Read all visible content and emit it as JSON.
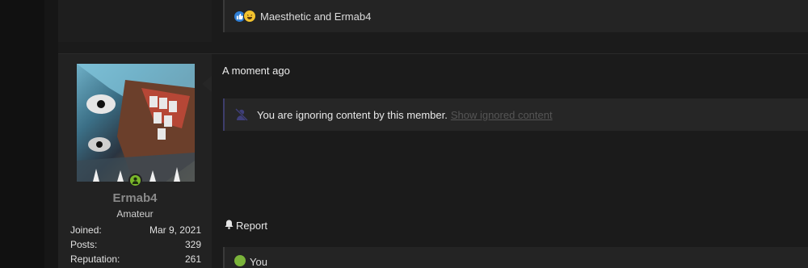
{
  "previous_post": {
    "reaction_users": "Maesthetic and Ermab4"
  },
  "post": {
    "timestamp": "A moment ago",
    "ignored_message": "You are ignoring content by this member.",
    "show_ignored_link": "Show ignored content",
    "report_label": "Report",
    "reaction_users": "You",
    "author": {
      "username": "Ermab4",
      "user_title": "Amateur",
      "online": true,
      "stats": [
        {
          "label": "Joined:",
          "value": "Mar 9, 2021"
        },
        {
          "label": "Posts:",
          "value": "329"
        },
        {
          "label": "Reputation:",
          "value": "261"
        }
      ]
    }
  },
  "icons": {
    "like": "like-icon",
    "haha": "haha-icon",
    "online": "user-online-icon",
    "mute": "muted-user-icon",
    "report": "bell-icon",
    "angry": "angry-icon"
  },
  "colors": {
    "online_green": "#79b72a",
    "username_gray": "#8a8a8a",
    "like_blue": "#2f7fd6"
  }
}
